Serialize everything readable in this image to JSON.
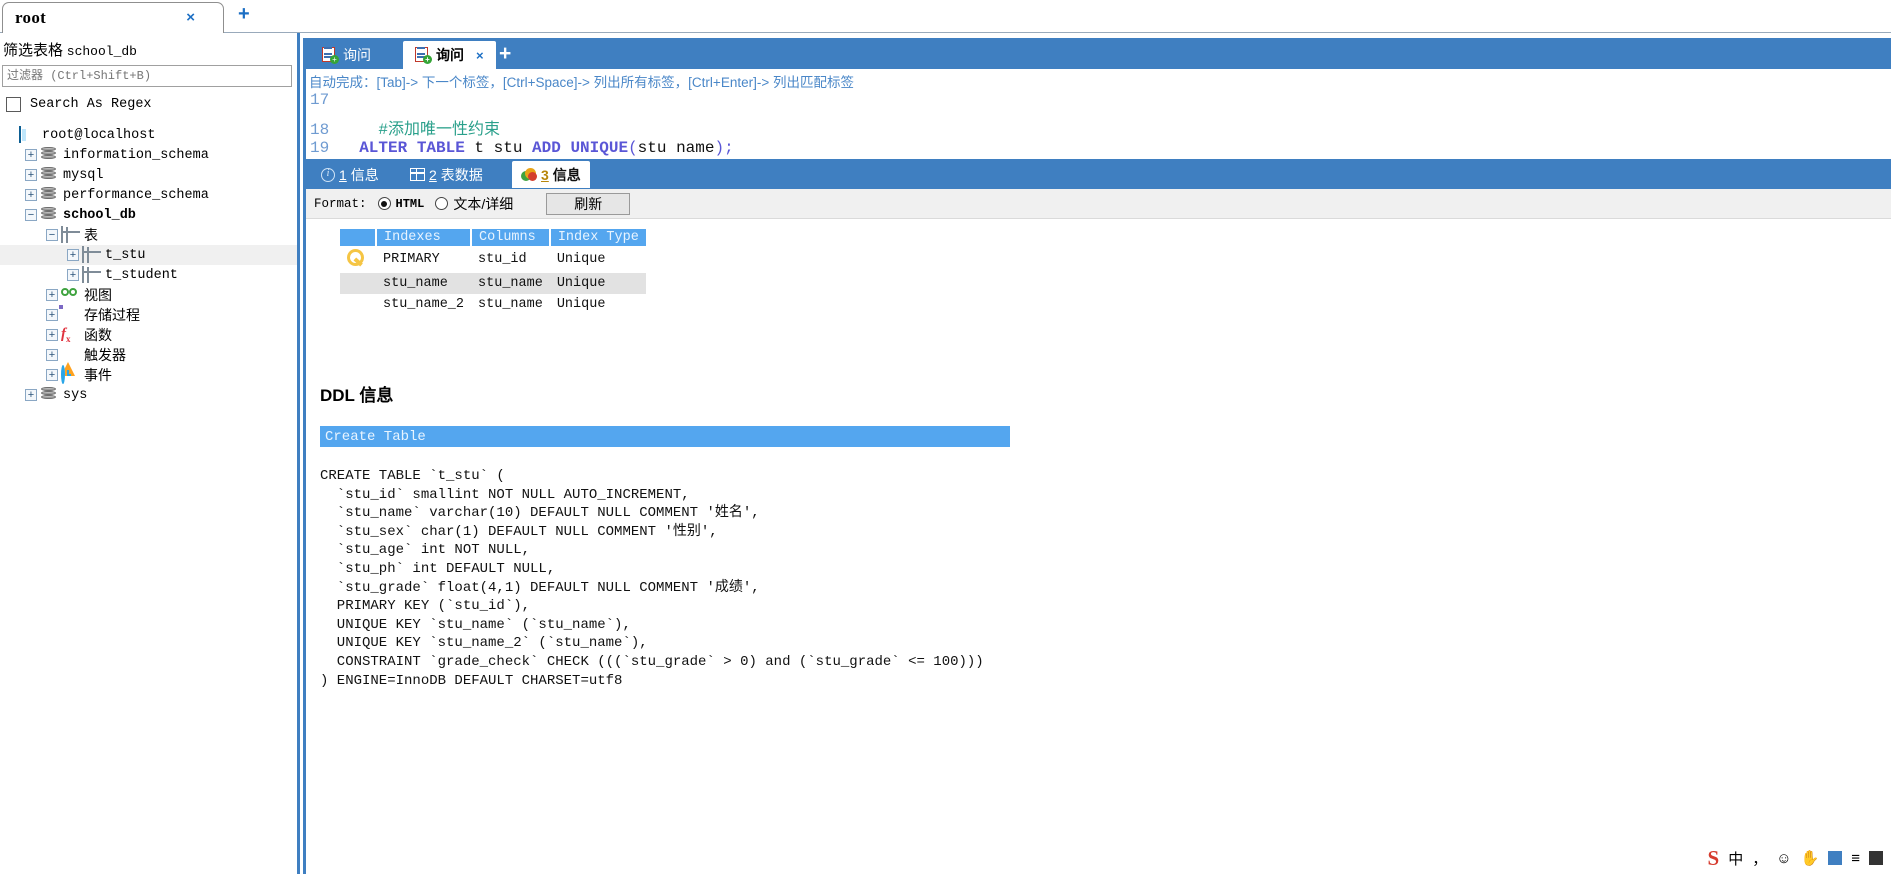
{
  "connection_tab": {
    "title": "root",
    "close_label": "×",
    "new_tab_label": "+"
  },
  "sidebar": {
    "filter_title_prefix": "筛选表格",
    "filter_title_db": "school_db",
    "filter_placeholder": "过滤器 (Ctrl+Shift+B)",
    "filter_value": "",
    "regex_label": "Search As Regex",
    "tree": [
      {
        "label": "root@localhost",
        "icon": "root-icon",
        "indent": 0,
        "expander": "",
        "bold": false,
        "cjk": false,
        "selected": false
      },
      {
        "label": "information_schema",
        "icon": "server-icon",
        "indent": 1,
        "expander": "+",
        "bold": false,
        "cjk": false,
        "selected": false
      },
      {
        "label": "mysql",
        "icon": "server-icon",
        "indent": 1,
        "expander": "+",
        "bold": false,
        "cjk": false,
        "selected": false
      },
      {
        "label": "performance_schema",
        "icon": "server-icon",
        "indent": 1,
        "expander": "+",
        "bold": false,
        "cjk": false,
        "selected": false
      },
      {
        "label": "school_db",
        "icon": "server-icon",
        "indent": 1,
        "expander": "−",
        "bold": true,
        "cjk": false,
        "selected": false
      },
      {
        "label": "表",
        "icon": "table-icon",
        "indent": 2,
        "expander": "−",
        "bold": false,
        "cjk": true,
        "selected": false
      },
      {
        "label": "t_stu",
        "icon": "table-icon",
        "indent": 3,
        "expander": "+",
        "bold": false,
        "cjk": false,
        "selected": true
      },
      {
        "label": "t_student",
        "icon": "table-icon",
        "indent": 3,
        "expander": "+",
        "bold": false,
        "cjk": false,
        "selected": false
      },
      {
        "label": "视图",
        "icon": "view-icon",
        "indent": 2,
        "expander": "+",
        "bold": false,
        "cjk": true,
        "selected": false
      },
      {
        "label": "存储过程",
        "icon": "gear-icon",
        "indent": 2,
        "expander": "+",
        "bold": false,
        "cjk": true,
        "selected": false
      },
      {
        "label": "函数",
        "icon": "function-icon",
        "indent": 2,
        "expander": "+",
        "bold": false,
        "cjk": true,
        "selected": false
      },
      {
        "label": "触发器",
        "icon": "trigger-icon",
        "indent": 2,
        "expander": "+",
        "bold": false,
        "cjk": true,
        "selected": false
      },
      {
        "label": "事件",
        "icon": "event-icon",
        "indent": 2,
        "expander": "+",
        "bold": false,
        "cjk": true,
        "selected": false
      },
      {
        "label": "sys",
        "icon": "server-icon",
        "indent": 1,
        "expander": "+",
        "bold": false,
        "cjk": false,
        "selected": false
      }
    ]
  },
  "query_tabs": {
    "items": [
      {
        "label": "询问",
        "active": false,
        "closable": false
      },
      {
        "label": "询问",
        "active": true,
        "closable": true
      }
    ],
    "close_label": "×",
    "new_tab_label": "+"
  },
  "editor": {
    "hint": "自动完成：[Tab]-> 下一个标签，[Ctrl+Space]-> 列出所有标签，[Ctrl+Enter]-> 列出匹配标签",
    "lines": [
      {
        "num": "17",
        "text": ""
      },
      {
        "num": "18",
        "text": "    #添加唯一性约束"
      },
      {
        "num": "19",
        "text": "  ALTER TABLE t_stu ADD UNIQUE(stu name);"
      }
    ],
    "line19_tokens": {
      "kw1": "ALTER TABLE",
      "ident": " t stu ",
      "kw2": "ADD UNIQUE",
      "open": "(",
      "cols": "stu name",
      "close": ");"
    }
  },
  "result_tabs": [
    {
      "num": "1",
      "label": "信息",
      "icon": "info-icon",
      "active": false
    },
    {
      "num": "2",
      "label": "表数据",
      "icon": "grid-icon",
      "active": false
    },
    {
      "num": "3",
      "label": "信息",
      "icon": "pie-chart-icon",
      "active": true
    }
  ],
  "format_bar": {
    "label": "Format:",
    "options": [
      {
        "label": "HTML",
        "selected": true,
        "style": "mono"
      },
      {
        "label": "文本/详细",
        "selected": false,
        "style": "cjk"
      }
    ],
    "refresh_label": "刷新"
  },
  "index_table": {
    "headers": [
      "",
      "Indexes",
      "Columns",
      "Index Type"
    ],
    "rows": [
      {
        "icon": "key-icon",
        "indexes": "PRIMARY",
        "columns": "stu_id",
        "index_type": "Unique",
        "alt": false
      },
      {
        "icon": "",
        "indexes": "stu_name",
        "columns": "stu_name",
        "index_type": "Unique",
        "alt": true
      },
      {
        "icon": "",
        "indexes": "stu_name_2",
        "columns": "stu_name",
        "index_type": "Unique",
        "alt": false
      }
    ]
  },
  "ddl": {
    "title": "DDL 信息",
    "header": "Create Table",
    "code": "CREATE TABLE `t_stu` (\n  `stu_id` smallint NOT NULL AUTO_INCREMENT,\n  `stu_name` varchar(10) DEFAULT NULL COMMENT '姓名',\n  `stu_sex` char(1) DEFAULT NULL COMMENT '性别',\n  `stu_age` int NOT NULL,\n  `stu_ph` int DEFAULT NULL,\n  `stu_grade` float(4,1) DEFAULT NULL COMMENT '成绩',\n  PRIMARY KEY (`stu_id`),\n  UNIQUE KEY `stu_name` (`stu_name`),\n  UNIQUE KEY `stu_name_2` (`stu_name`),\n  CONSTRAINT `grade_check` CHECK (((`stu_grade` > 0) and (`stu_grade` <= 100)))\n) ENGINE=InnoDB DEFAULT CHARSET=utf8"
  },
  "ime_tray": {
    "logo": "S",
    "items": [
      "中",
      "，",
      "☺",
      "✋",
      "▦",
      "≡",
      "↓",
      "☰"
    ]
  },
  "colors": {
    "accent_blue": "#3f7fc1",
    "header_blue": "#54a6ef",
    "comment_green": "#2aa08b",
    "keyword_purple": "#5a56d6",
    "linenum_blue": "#6f9bd1"
  }
}
